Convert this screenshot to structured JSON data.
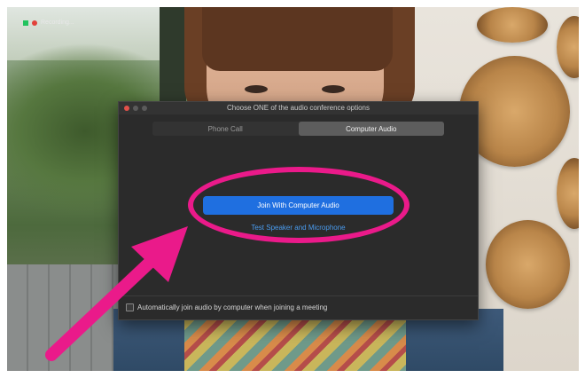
{
  "recording": {
    "label": "Recording..."
  },
  "dialog": {
    "title": "Choose ONE of the audio conference options",
    "tabs": [
      {
        "label": "Phone Call",
        "active": false
      },
      {
        "label": "Computer Audio",
        "active": true
      }
    ],
    "join_button": "Join With Computer Audio",
    "test_link": "Test Speaker and Microphone",
    "auto_join_label": "Automatically join audio by computer when joining a meeting",
    "auto_join_checked": false
  },
  "annotation": {
    "color": "#ea1a8a"
  },
  "colors": {
    "accent_blue": "#1f6fe0",
    "link_blue": "#4a9cf0",
    "dialog_bg": "#2b2b2b"
  }
}
